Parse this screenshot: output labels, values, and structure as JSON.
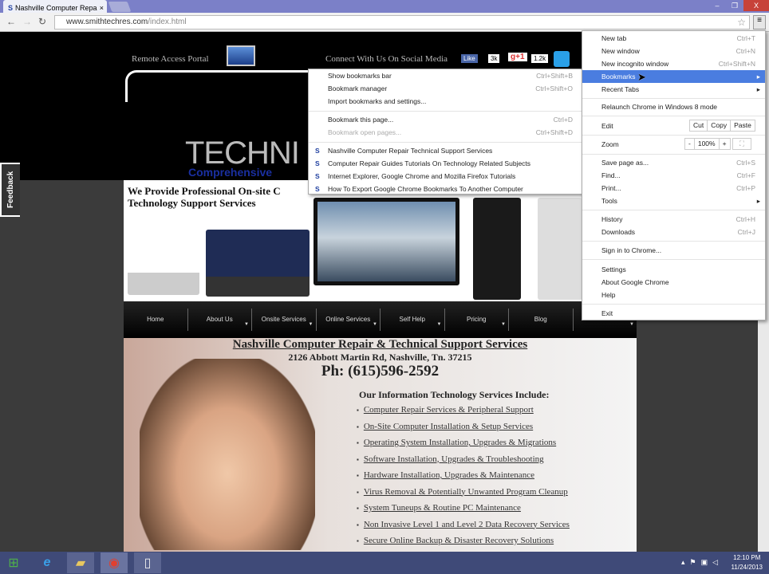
{
  "browser": {
    "tab_title": "Nashville Computer Repai",
    "url_host": "www.smithtechres.com",
    "url_path": "/index.html"
  },
  "page": {
    "remote_access": "Remote Access Portal",
    "social": "Connect With Us On Social Media",
    "fb_like": "Like",
    "fb_count": "3k",
    "gplus": "g+1",
    "gplus_count": "1.2k",
    "logo": "TECHNI",
    "logo_sub": "Comprehensive",
    "feedback": "Feedback",
    "tagline": "We Provide Professional On-site C Technology Support Services",
    "nav": [
      "Home",
      "About Us",
      "Onsite Services",
      "Online Services",
      "Self Help",
      "Pricing",
      "Blog",
      ""
    ],
    "title": "Nashville Computer Repair & Technical Support Services",
    "address": "2126 Abbott Martin Rd, Nashville, Tn. 37215",
    "phone": "Ph: (615)596-2592",
    "services_heading": "Our Information Technology Services Include:",
    "services": [
      "Computer Repair Services & Peripheral Support",
      "On-Site Computer Installation & Setup Services",
      "Operating System Installation, Upgrades & Migrations",
      "Software Installation, Upgrades & Troubleshooting",
      "Hardware Installation, Upgrades & Maintenance",
      "Virus Removal & Potentially Unwanted Program Cleanup",
      "System Tuneups & Routine PC Maintenance",
      "Non Invasive Level 1 and Level 2 Data Recovery Services",
      "Secure Online Backup & Disaster Recovery Solutions"
    ]
  },
  "bookmarks_menu": {
    "items": [
      {
        "label": "Show bookmarks bar",
        "shortcut": "Ctrl+Shift+B"
      },
      {
        "label": "Bookmark manager",
        "shortcut": "Ctrl+Shift+O"
      },
      {
        "label": "Import bookmarks and settings...",
        "shortcut": ""
      },
      {
        "label": "Bookmark this page...",
        "shortcut": "Ctrl+D"
      },
      {
        "label": "Bookmark open pages...",
        "shortcut": "Ctrl+Shift+D"
      }
    ],
    "bookmarks": [
      "Nashville Computer Repair  Technical Support Services",
      "Computer Repair Guides  Tutorials On Technology Related Subjects",
      "Internet Explorer, Google Chrome and Mozilla Firefox Tutorials",
      "How To Export Google Chrome Bookmarks To Another Computer"
    ]
  },
  "chrome_menu": {
    "new_tab": "New tab",
    "new_tab_sc": "Ctrl+T",
    "new_window": "New window",
    "new_window_sc": "Ctrl+N",
    "incognito": "New incognito window",
    "incognito_sc": "Ctrl+Shift+N",
    "bookmarks": "Bookmarks",
    "recent_tabs": "Recent Tabs",
    "relaunch": "Relaunch Chrome in Windows 8 mode",
    "edit": "Edit",
    "cut": "Cut",
    "copy": "Copy",
    "paste": "Paste",
    "zoom": "Zoom",
    "zoom_minus": "-",
    "zoom_value": "100%",
    "zoom_plus": "+",
    "save": "Save page as...",
    "save_sc": "Ctrl+S",
    "find": "Find...",
    "find_sc": "Ctrl+F",
    "print": "Print...",
    "print_sc": "Ctrl+P",
    "tools": "Tools",
    "history": "History",
    "history_sc": "Ctrl+H",
    "downloads": "Downloads",
    "downloads_sc": "Ctrl+J",
    "signin": "Sign in to Chrome...",
    "settings": "Settings",
    "about": "About Google Chrome",
    "help": "Help",
    "exit": "Exit"
  },
  "taskbar": {
    "time": "12:10 PM",
    "date": "11/24/2013"
  }
}
